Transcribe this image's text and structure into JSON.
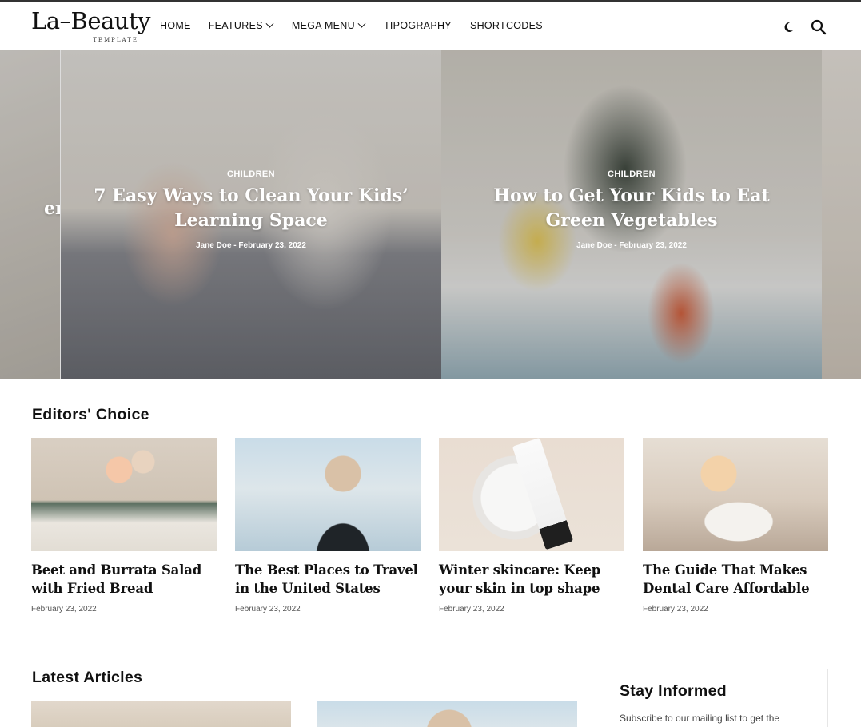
{
  "brand": {
    "name": "La–Beauty",
    "tagline": "TEMPLATE"
  },
  "nav": [
    {
      "label": "HOME",
      "dropdown": false
    },
    {
      "label": "FEATURES",
      "dropdown": true
    },
    {
      "label": "MEGA MENU",
      "dropdown": true
    },
    {
      "label": "TIPOGRAPHY",
      "dropdown": false
    },
    {
      "label": "SHORTCODES",
      "dropdown": false
    }
  ],
  "header_icons": [
    "moon-icon",
    "search-icon"
  ],
  "hero": {
    "partial_left_title": "ern",
    "slides": [
      {
        "category": "CHILDREN",
        "title": "7 Easy Ways to Clean Your Kids’ Learning Space",
        "meta": "Jane Doe - February 23, 2022"
      },
      {
        "category": "CHILDREN",
        "title": "How to Get Your Kids to Eat Green Vegetables",
        "meta": "Jane Doe - February 23, 2022"
      }
    ]
  },
  "editors_choice": {
    "title": "Editors' Choice",
    "cards": [
      {
        "title": "Beet and Burrata Salad with Fried Bread",
        "date": "February 23, 2022"
      },
      {
        "title": "The Best Places to Travel in the United States",
        "date": "February 23, 2022"
      },
      {
        "title": "Winter skincare: Keep your skin in top shape",
        "date": "February 23, 2022"
      },
      {
        "title": "The Guide That Makes Dental Care Affordable",
        "date": "February 23, 2022"
      }
    ]
  },
  "latest_articles": {
    "title": "Latest Articles"
  },
  "stay_informed": {
    "title": "Stay Informed",
    "text": "Subscribe to our mailing list to get the"
  }
}
